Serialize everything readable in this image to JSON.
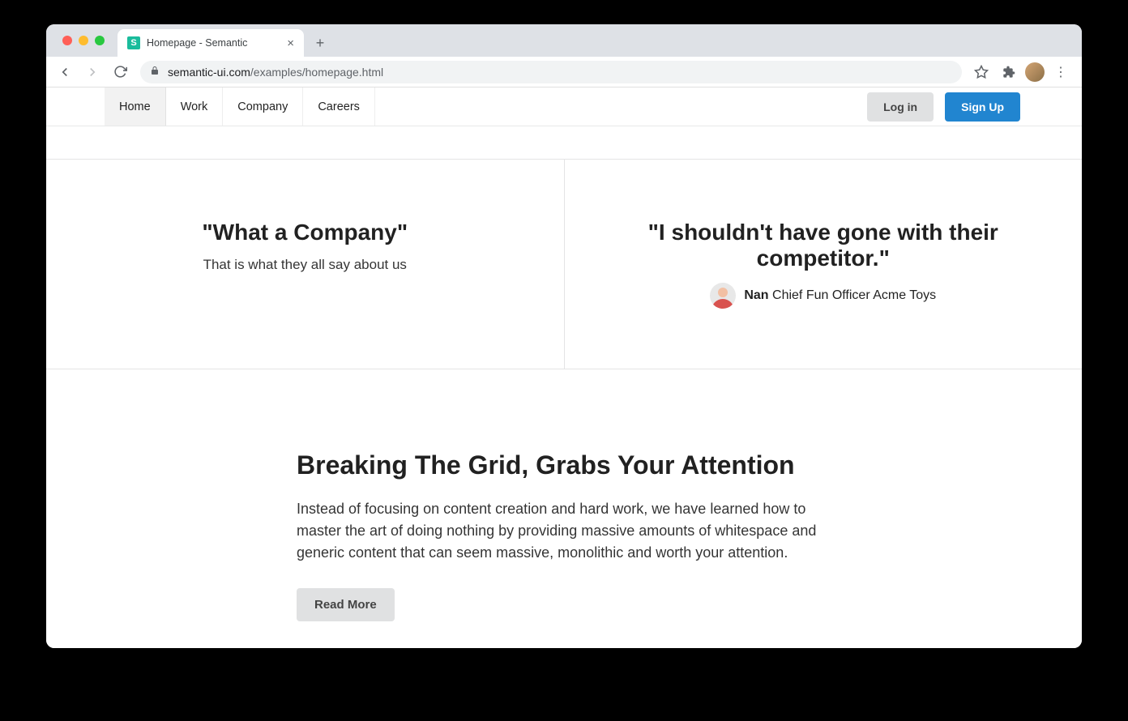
{
  "browser": {
    "tab_title": "Homepage - Semantic",
    "url_domain": "semantic-ui.com",
    "url_path": "/examples/homepage.html"
  },
  "nav": {
    "items": [
      "Home",
      "Work",
      "Company",
      "Careers"
    ],
    "login_label": "Log in",
    "signup_label": "Sign Up"
  },
  "quotes": {
    "left": {
      "headline": "\"What a Company\"",
      "sub": "That is what they all say about us"
    },
    "right": {
      "headline": "\"I shouldn't have gone with their competitor.\"",
      "attr_name": "Nan",
      "attr_title": "Chief Fun Officer Acme Toys"
    }
  },
  "text": {
    "headline": "Breaking The Grid, Grabs Your Attention",
    "body": "Instead of focusing on content creation and hard work, we have learned how to master the art of doing nothing by providing massive amounts of whitespace and generic content that can seem massive, monolithic and worth your attention.",
    "readmore_label": "Read More"
  }
}
